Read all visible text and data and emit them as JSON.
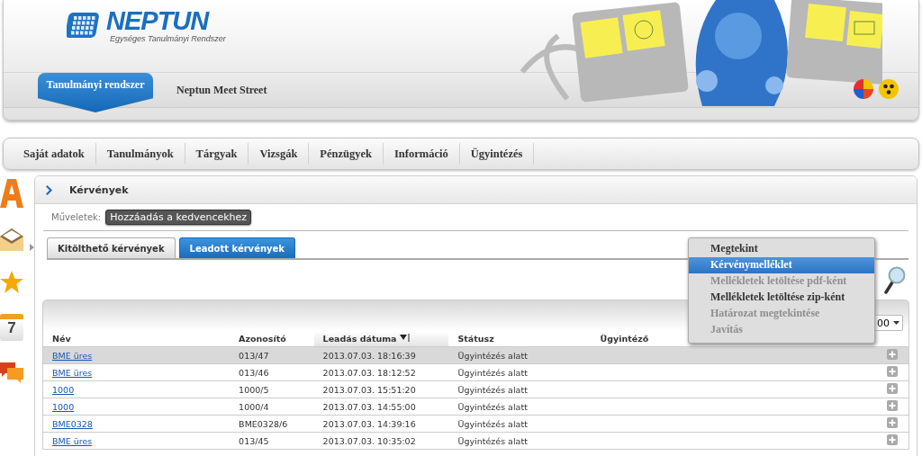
{
  "header": {
    "logo": {
      "name": "NEPTUN",
      "subtitle": "Egységes Tanulmányi Rendszer"
    },
    "systems": [
      {
        "label": "Tanulmányi rendszer",
        "selected": true
      },
      {
        "label": "Neptun Meet Street",
        "selected": false
      }
    ]
  },
  "main_menu": [
    "Saját adatok",
    "Tanulmányok",
    "Tárgyak",
    "Vizsgák",
    "Pénzügyek",
    "Információ",
    "Ügyintézés"
  ],
  "sidebar": {
    "calendar_day": "7"
  },
  "page": {
    "title": "Kérvények",
    "actions_label": "Műveletek:",
    "actions": [
      "Hozzáadás a kedvencekhez"
    ],
    "tabs": [
      {
        "label": "Kitölthető kérvények",
        "selected": false
      },
      {
        "label": "Leadott kérvények",
        "selected": true
      }
    ],
    "page_size": "00",
    "table": {
      "columns": [
        {
          "label": "Név",
          "sorted": false
        },
        {
          "label": "Azonosító",
          "sorted": false
        },
        {
          "label": "Leadás dátuma",
          "sorted": true
        },
        {
          "label": "Státusz",
          "sorted": false
        },
        {
          "label": "Ügyintéző",
          "sorted": false
        }
      ],
      "rows": [
        {
          "name": "BME üres",
          "id": "013/47",
          "date": "2013.07.03. 18:16:39",
          "status": "Ügyintézés alatt",
          "selected": true
        },
        {
          "name": "BME üres",
          "id": "013/46",
          "date": "2013.07.03. 18:12:52",
          "status": "Ügyintézés alatt",
          "selected": false
        },
        {
          "name": "1000",
          "id": "1000/5",
          "date": "2013.07.03. 15:51:20",
          "status": "Ügyintézés alatt",
          "selected": false
        },
        {
          "name": "1000",
          "id": "1000/4",
          "date": "2013.07.03. 14:55:00",
          "status": "Ügyintézés alatt",
          "selected": false
        },
        {
          "name": "BME0328",
          "id": "BME0328/6",
          "date": "2013.07.03. 14:39:16",
          "status": "Ügyintézés alatt",
          "selected": false
        },
        {
          "name": "BME üres",
          "id": "013/45",
          "date": "2013.07.03. 10:35:02",
          "status": "Ügyintézés alatt",
          "selected": false
        }
      ]
    },
    "context_menu": [
      {
        "label": "Megtekint",
        "disabled": false,
        "selected": false
      },
      {
        "label": "Kérvénymelléklet",
        "disabled": false,
        "selected": true
      },
      {
        "label": "Mellékletek letöltése pdf-ként",
        "disabled": true,
        "selected": false
      },
      {
        "label": "Mellékletek letöltése zip-ként",
        "disabled": false,
        "selected": false
      },
      {
        "label": "Határozat megtekintése",
        "disabled": true,
        "selected": false
      },
      {
        "label": "Javítás",
        "disabled": true,
        "selected": false
      }
    ]
  }
}
